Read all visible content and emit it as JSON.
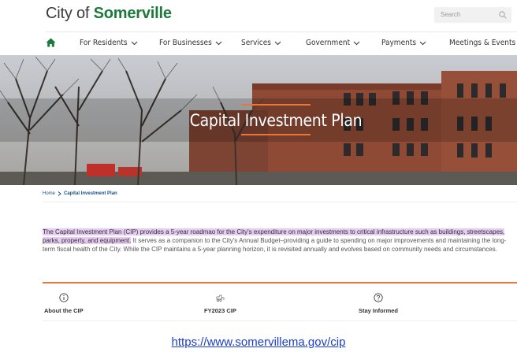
{
  "site": {
    "logo_prefix": "City of ",
    "logo_bold": "Somerville"
  },
  "search": {
    "placeholder": "Search"
  },
  "nav": {
    "items": [
      {
        "label": "For Residents"
      },
      {
        "label": "For Businesses"
      },
      {
        "label": "Services"
      },
      {
        "label": "Government"
      },
      {
        "label": "Payments"
      },
      {
        "label": "Meetings & Events"
      }
    ]
  },
  "hero": {
    "title": "Capital Investment Plan"
  },
  "breadcrumb": {
    "home": "Home",
    "current": "Capital Investment Plan"
  },
  "intro": {
    "highlighted": "The Capital Investment Plan (CIP) provides a 5-year roadmao for the City's expenditure on major investments to critical infrastructure such as buildings, streetscapes, parks, property, and equipment.",
    "rest": " It serves as a companion to the City's Annual Budget–providing a guide to spending on major improvements and maintaining the long-term fiscal health of the City. While the CIP maintains a 5-year planning horizon, it is revisited annually and evolves based on community needs and circumstances."
  },
  "tabs": [
    {
      "label": "About the CIP",
      "icon": "info-icon"
    },
    {
      "label": "FY2023 CIP",
      "icon": "bulldozer-icon"
    },
    {
      "label": "Stay Informed",
      "icon": "question-icon"
    }
  ],
  "footer": {
    "url": "https://www.somervillema.gov/cip"
  },
  "colors": {
    "brand_green": "#1b7a3b",
    "accent_orange": "#e8763b",
    "link_blue": "#1a3ecf",
    "highlight": "#e6ccf2"
  }
}
